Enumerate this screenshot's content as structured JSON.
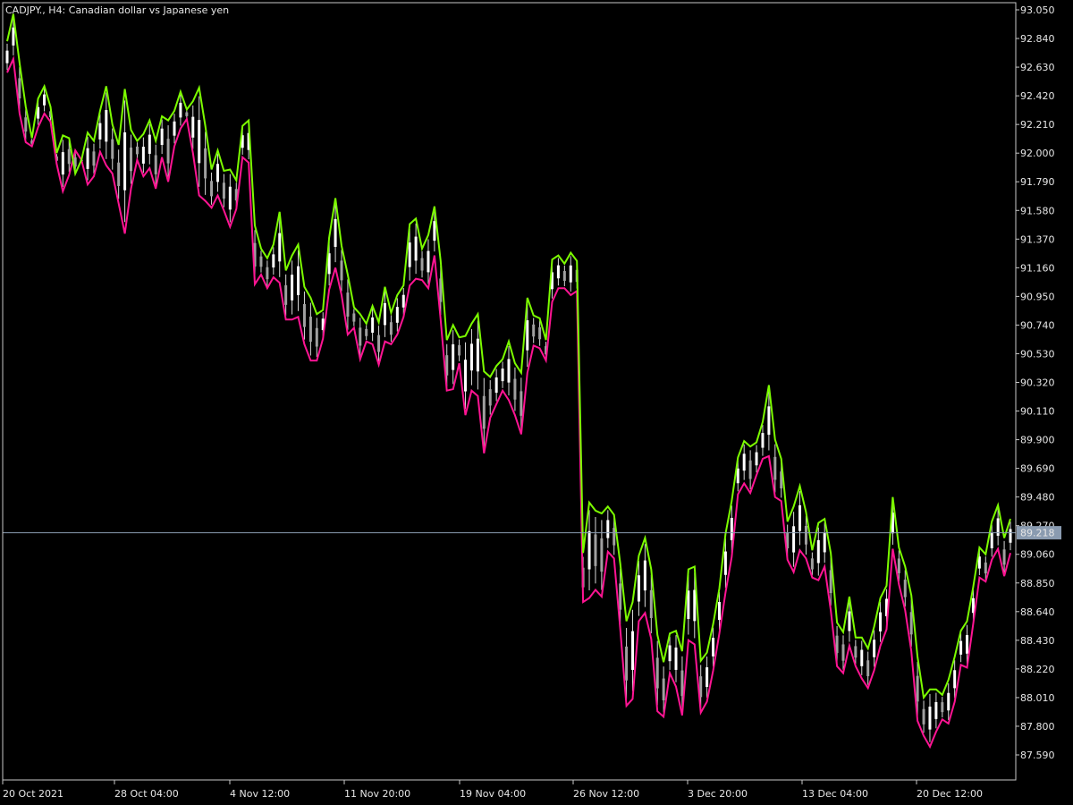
{
  "window": {
    "symbol": "CADJPY.",
    "timeframe": "H4",
    "description": "Canadian dollar vs Japanese yen",
    "title": "CADJPY., H4:  Canadian dollar vs Japanese yen"
  },
  "colors": {
    "background": "#000000",
    "frame": "#c8c8c8",
    "text": "#e6e6e6",
    "upper_line": "#7cfc00",
    "lower_line": "#ff1493",
    "candle_bull": "#ffffff",
    "candle_bear": "#a0a0a0",
    "price_line": "#8a9bb0",
    "price_badge": "#8a9bb0"
  },
  "chart_data": {
    "type": "line",
    "chart_kind": "candlestick with indicator envelope",
    "x_axis_labels": [
      "20 Oct 2021",
      "28 Oct 04:00",
      "4 Nov 12:00",
      "11 Nov 20:00",
      "19 Nov 04:00",
      "26 Nov 12:00",
      "3 Dec 20:00",
      "13 Dec 04:00",
      "20 Dec 12:00"
    ],
    "y_axis_labels": [
      "93.050",
      "92.840",
      "92.630",
      "92.420",
      "92.210",
      "92.000",
      "91.790",
      "91.580",
      "91.370",
      "91.160",
      "90.950",
      "90.740",
      "90.530",
      "90.320",
      "90.110",
      "89.900",
      "89.690",
      "89.480",
      "89.270",
      "89.060",
      "88.850",
      "88.640",
      "88.430",
      "88.220",
      "88.010",
      "87.800",
      "87.590"
    ],
    "ylim": [
      87.41,
      93.1
    ],
    "grid": false,
    "current_price": 89.218,
    "current_price_label": "89.218",
    "series": [
      {
        "name": "",
        "color": "#7cfc00",
        "values": [
          92.82,
          93.02,
          92.66,
          92.34,
          92.11,
          92.4,
          92.49,
          92.34,
          92.0,
          92.13,
          92.11,
          91.85,
          91.95,
          92.15,
          92.09,
          92.31,
          92.49,
          92.21,
          92.06,
          92.47,
          92.17,
          92.09,
          92.14,
          92.24,
          92.09,
          92.27,
          92.24,
          92.31,
          92.45,
          92.32,
          92.38,
          92.48,
          92.2,
          91.88,
          92.02,
          91.87,
          91.88,
          91.8,
          92.2,
          92.24,
          91.47,
          91.3,
          91.23,
          91.33,
          91.57,
          91.14,
          91.25,
          91.33,
          91.02,
          90.94,
          90.82,
          90.85,
          91.38,
          91.67,
          91.32,
          91.11,
          90.87,
          90.82,
          90.75,
          90.88,
          90.76,
          91.02,
          90.83,
          90.96,
          91.03,
          91.48,
          91.52,
          91.3,
          91.4,
          91.61,
          91.21,
          90.63,
          90.74,
          90.65,
          90.66,
          90.75,
          90.82,
          90.4,
          90.36,
          90.44,
          90.49,
          90.62,
          90.46,
          90.39,
          90.94,
          90.81,
          90.79,
          90.63,
          91.22,
          91.25,
          91.19,
          91.27,
          91.21,
          89.07,
          89.44,
          89.38,
          89.36,
          89.41,
          89.35,
          88.99,
          88.57,
          88.71,
          89.05,
          89.18,
          88.95,
          88.47,
          88.27,
          88.48,
          88.5,
          88.35,
          88.95,
          88.97,
          88.28,
          88.34,
          88.55,
          88.81,
          89.21,
          89.45,
          89.77,
          89.89,
          89.85,
          89.88,
          90.03,
          90.3,
          89.9,
          89.76,
          89.3,
          89.41,
          89.56,
          89.37,
          89.09,
          89.29,
          89.32,
          89.07,
          88.56,
          88.49,
          88.75,
          88.45,
          88.45,
          88.37,
          88.53,
          88.74,
          88.83,
          89.48,
          89.11,
          88.97,
          88.76,
          88.31,
          88.01,
          88.07,
          88.07,
          88.03,
          88.14,
          88.31,
          88.5,
          88.57,
          88.82,
          89.11,
          89.06,
          89.3,
          89.42,
          89.18,
          89.32
        ]
      },
      {
        "name": "",
        "color": "#ff1493",
        "values": [
          92.59,
          92.69,
          92.29,
          92.08,
          92.05,
          92.19,
          92.29,
          92.23,
          91.92,
          91.72,
          91.84,
          92.02,
          91.95,
          91.77,
          91.83,
          92.01,
          91.91,
          91.85,
          91.63,
          91.41,
          91.74,
          91.95,
          91.83,
          91.89,
          91.74,
          91.97,
          91.79,
          92.05,
          92.18,
          92.25,
          92.0,
          91.69,
          91.65,
          91.6,
          91.69,
          91.58,
          91.46,
          91.59,
          91.97,
          91.93,
          91.04,
          91.11,
          91.01,
          91.09,
          91.05,
          90.78,
          90.78,
          90.8,
          90.6,
          90.48,
          90.48,
          90.64,
          91.0,
          91.16,
          90.96,
          90.67,
          90.72,
          90.49,
          90.62,
          90.6,
          90.45,
          90.62,
          90.6,
          90.67,
          90.8,
          91.03,
          91.08,
          91.07,
          91.01,
          91.25,
          90.78,
          90.26,
          90.27,
          90.46,
          90.08,
          90.26,
          90.22,
          89.8,
          90.06,
          90.16,
          90.26,
          90.19,
          90.08,
          89.94,
          90.39,
          90.59,
          90.57,
          90.48,
          90.91,
          91.01,
          91.01,
          90.96,
          90.99,
          88.71,
          88.74,
          88.8,
          88.75,
          89.08,
          89.03,
          88.51,
          87.95,
          88.0,
          88.57,
          88.63,
          88.44,
          87.91,
          87.87,
          88.19,
          88.09,
          87.88,
          88.43,
          88.4,
          87.9,
          87.98,
          88.21,
          88.48,
          88.78,
          89.04,
          89.5,
          89.58,
          89.51,
          89.64,
          89.76,
          89.78,
          89.48,
          89.45,
          89.02,
          88.93,
          89.09,
          89.03,
          88.89,
          88.87,
          88.97,
          88.65,
          88.24,
          88.19,
          88.39,
          88.24,
          88.15,
          88.08,
          88.21,
          88.39,
          88.51,
          89.1,
          88.84,
          88.65,
          88.35,
          87.84,
          87.73,
          87.65,
          87.76,
          87.85,
          87.82,
          87.98,
          88.25,
          88.23,
          88.55,
          88.89,
          88.86,
          89.02,
          89.1,
          88.9,
          89.07
        ]
      }
    ]
  }
}
